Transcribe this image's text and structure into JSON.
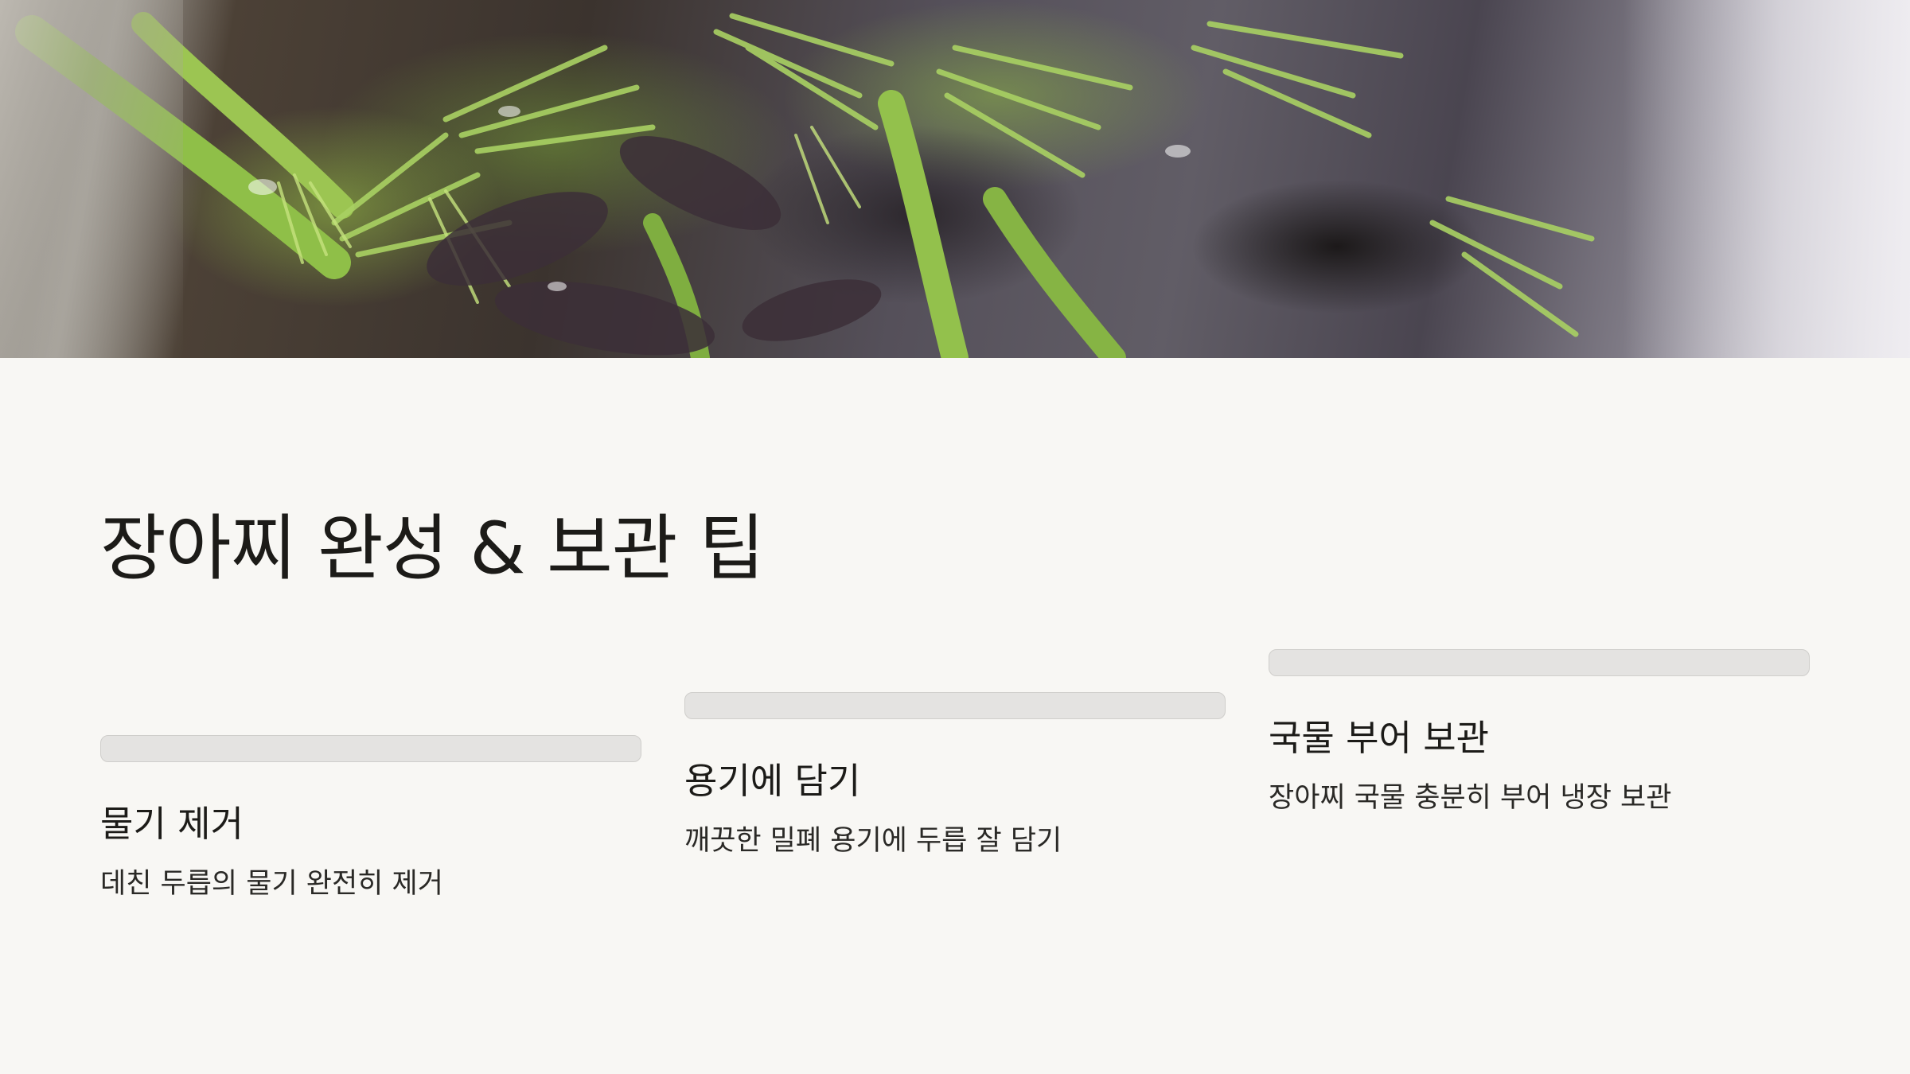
{
  "slide": {
    "hero_image_alt": "",
    "title": "장아찌 완성 & 보관 팁",
    "steps": [
      {
        "title": "물기 제거",
        "description": "데친 두릅의 물기 완전히 제거"
      },
      {
        "title": "용기에 담기",
        "description": "깨끗한 밀폐 용기에 두릅 잘 담기"
      },
      {
        "title": "국물 부어 보관",
        "description": "장아찌 국물 충분히 부어 냉장 보관"
      }
    ]
  },
  "colors": {
    "background": "#f8f7f4",
    "text": "#1c1b18",
    "step_bar": "#e4e3e1"
  }
}
